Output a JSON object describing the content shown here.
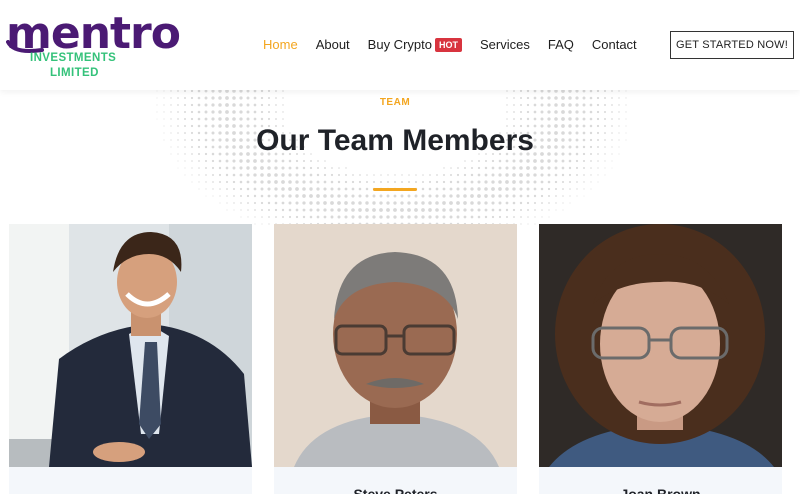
{
  "brand": {
    "name": "mentro",
    "sub_line1": "INVESTMENTS",
    "sub_line2": "LIMITED",
    "primary_color": "#4b1a74",
    "accent_green": "#34c27a"
  },
  "nav": {
    "items": [
      {
        "label": "Home",
        "active": true
      },
      {
        "label": "About"
      },
      {
        "label": "Buy Crypto",
        "badge": "HOT"
      },
      {
        "label": "Services"
      },
      {
        "label": "FAQ"
      },
      {
        "label": "Contact"
      }
    ],
    "cta_label": "GET STARTED NOW!"
  },
  "section": {
    "eyebrow": "TEAM",
    "title": "Our Team Members",
    "accent_color": "#f3a620"
  },
  "team": [
    {
      "name": "",
      "photo_icon": "smiling-man-in-suit-photo"
    },
    {
      "name": "Steve Peters",
      "photo_icon": "man-with-glasses-photo"
    },
    {
      "name": "Joan Brown",
      "photo_icon": "woman-with-glasses-photo"
    }
  ]
}
